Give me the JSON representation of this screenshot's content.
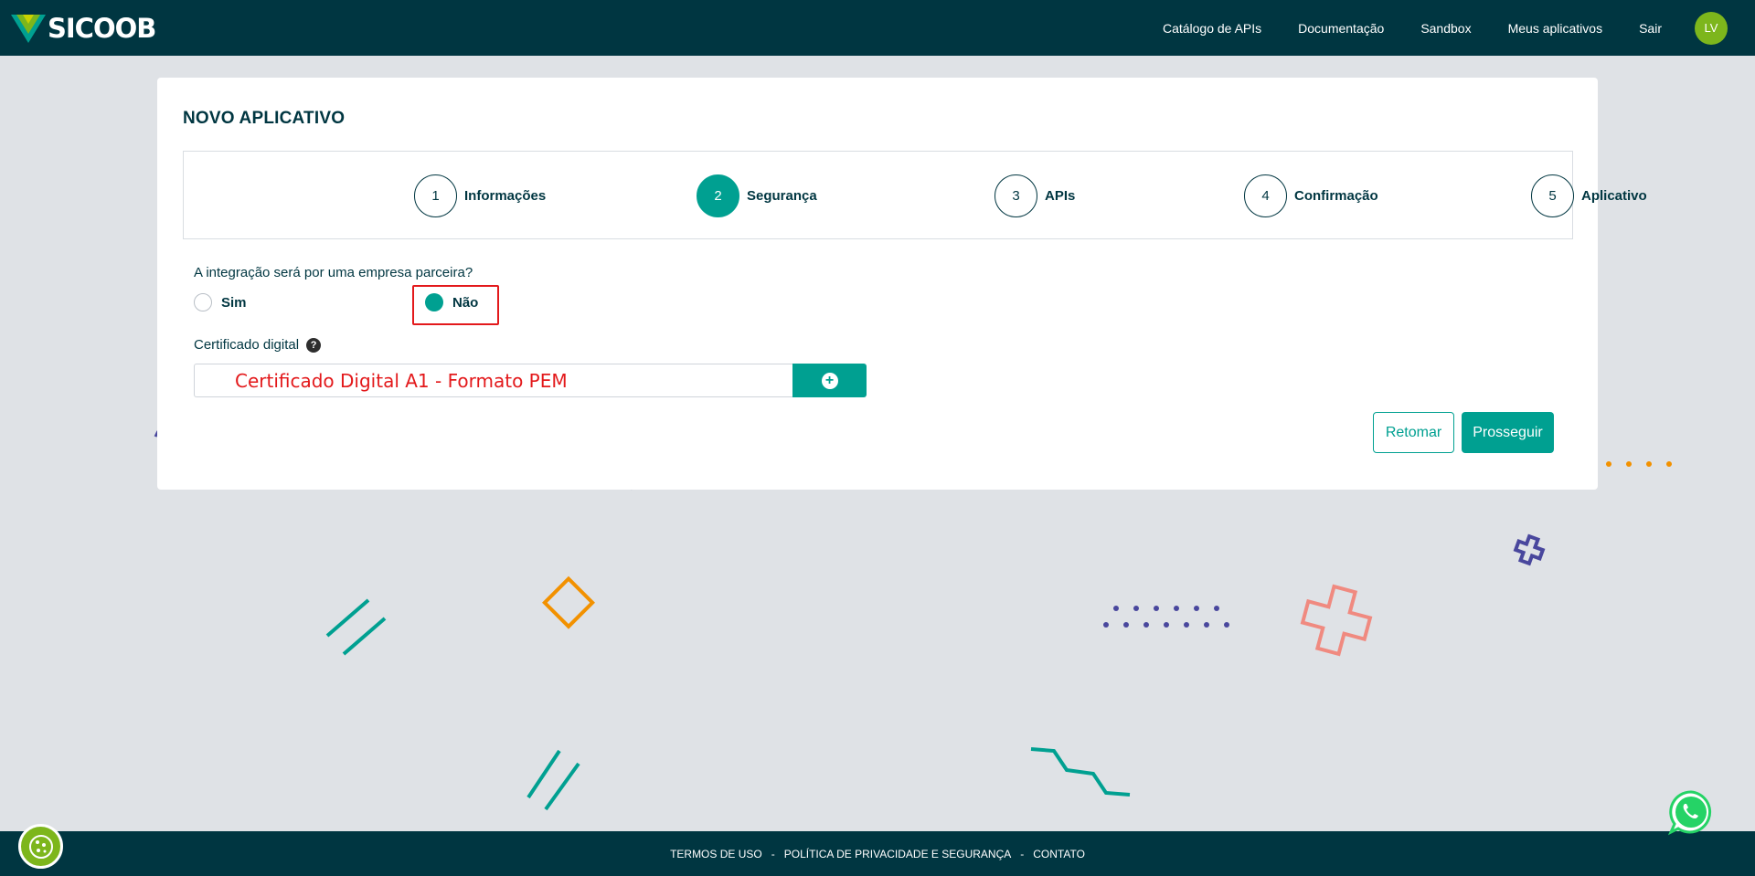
{
  "header": {
    "logo_text": "SICOOB",
    "nav": [
      "Catálogo de APIs",
      "Documentação",
      "Sandbox",
      "Meus aplicativos",
      "Sair"
    ],
    "avatar_initials": "LV"
  },
  "card": {
    "title": "NOVO APLICATIVO",
    "steps": [
      {
        "number": "1",
        "label": "Informações",
        "active": false
      },
      {
        "number": "2",
        "label": "Segurança",
        "active": true
      },
      {
        "number": "3",
        "label": "APIs",
        "active": false
      },
      {
        "number": "4",
        "label": "Confirmação",
        "active": false
      },
      {
        "number": "5",
        "label": "Aplicativo",
        "active": false
      }
    ],
    "question": "A integração será por uma empresa parceira?",
    "options": [
      {
        "label": "Sim",
        "checked": false
      },
      {
        "label": "Não",
        "checked": true
      }
    ],
    "cert_label": "Certificado digital",
    "help_icon_text": "?",
    "cert_placeholder": "Certificado Digital A1 - Formato PEM",
    "add_icon": "+",
    "back_button": "Retomar",
    "next_button": "Prosseguir"
  },
  "footer": {
    "links": [
      "TERMOS DE USO",
      "POLÍTICA DE PRIVACIDADE E SEGURANÇA",
      "CONTATO"
    ],
    "separator": "-"
  },
  "colors": {
    "brand_dark": "#003641",
    "brand_teal": "#00a091",
    "brand_green": "#7db61c",
    "highlight_red": "#e3191b"
  }
}
